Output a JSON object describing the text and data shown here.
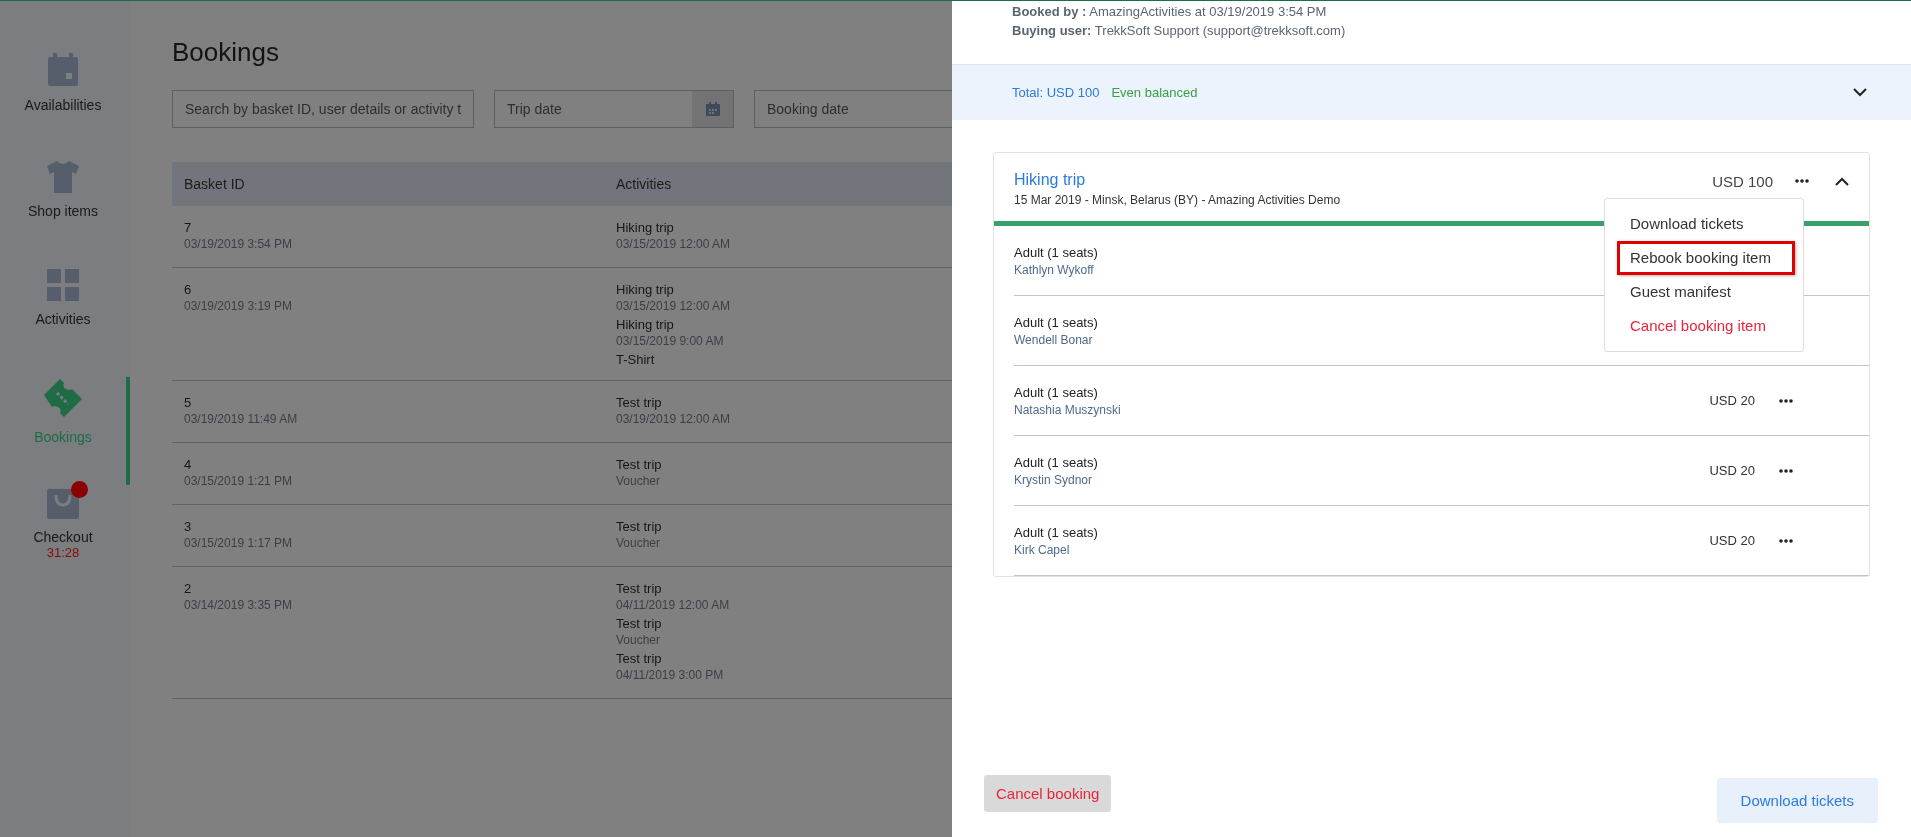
{
  "sidebar": {
    "items": [
      {
        "label": "Availabilities",
        "selected": false
      },
      {
        "label": "Shop items",
        "selected": false
      },
      {
        "label": "Activities",
        "selected": false
      },
      {
        "label": "Bookings",
        "selected": true
      },
      {
        "label": "Checkout",
        "selected": false,
        "notification": true,
        "timer": "31:28"
      }
    ]
  },
  "page": {
    "title": "Bookings",
    "filters": [
      {
        "kind": "text",
        "placeholder": "Search by basket ID, user details or activity t"
      },
      {
        "kind": "date",
        "placeholder": "Trip date"
      },
      {
        "kind": "date",
        "placeholder": "Booking date"
      }
    ],
    "table": {
      "columns": [
        "Basket ID",
        "Activities"
      ],
      "rows": [
        {
          "id": "7",
          "created": "03/19/2019 3:54 PM",
          "activities": [
            {
              "name": "Hiking trip",
              "detail": "03/15/2019 12:00 AM"
            }
          ]
        },
        {
          "id": "6",
          "created": "03/19/2019 3:19 PM",
          "activities": [
            {
              "name": "Hiking trip",
              "detail": "03/15/2019 12:00 AM"
            },
            {
              "name": "Hiking trip",
              "detail": "03/15/2019 9:00 AM"
            },
            {
              "name": "T-Shirt"
            }
          ]
        },
        {
          "id": "5",
          "created": "03/19/2019 11:49 AM",
          "activities": [
            {
              "name": "Test trip",
              "detail": "03/19/2019 12:00 AM"
            }
          ]
        },
        {
          "id": "4",
          "created": "03/15/2019 1:21 PM",
          "activities": [
            {
              "name": "Test trip",
              "detail": "Voucher"
            }
          ]
        },
        {
          "id": "3",
          "created": "03/15/2019 1:17 PM",
          "activities": [
            {
              "name": "Test trip",
              "detail": "Voucher"
            }
          ]
        },
        {
          "id": "2",
          "created": "03/14/2019 3:35 PM",
          "activities": [
            {
              "name": "Test trip",
              "detail": "04/11/2019 12:00 AM"
            },
            {
              "name": "Test trip",
              "detail": "Voucher"
            },
            {
              "name": "Test trip",
              "detail": "04/11/2019 3:00 PM"
            }
          ]
        }
      ]
    }
  },
  "drawer": {
    "info": [
      {
        "label": "Booked by :",
        "value": "AmazingActivities at 03/19/2019 3:54 PM"
      },
      {
        "label": "Buying user:",
        "value": "TrekkSoft Support (support@trekksoft.com)"
      }
    ],
    "total": {
      "amount": "Total: USD 100",
      "balance": "Even balanced",
      "expanded": false
    },
    "item": {
      "title": "Hiking trip",
      "subtitle": "15 Mar 2019 - Minsk, Belarus (BY) - Amazing Activities Demo",
      "price": "USD 100",
      "expanded": true,
      "rows": [
        {
          "type": "Adult (1 seats)",
          "guest": "Kathlyn Wykoff"
        },
        {
          "type": "Adult (1 seats)",
          "guest": "Wendell Bonar"
        },
        {
          "type": "Adult (1 seats)",
          "guest": "Natashia Muszynski",
          "price": "USD 20"
        },
        {
          "type": "Adult (1 seats)",
          "guest": "Krystin Sydnor",
          "price": "USD 20"
        },
        {
          "type": "Adult (1 seats)",
          "guest": "Kirk Capel",
          "price": "USD 20"
        }
      ],
      "menu": [
        {
          "label": "Download tickets",
          "kind": "normal",
          "highlighted": false
        },
        {
          "label": "Rebook booking item",
          "kind": "normal",
          "highlighted": true
        },
        {
          "label": "Guest manifest",
          "kind": "normal",
          "highlighted": false
        },
        {
          "label": "Cancel booking item",
          "kind": "danger",
          "highlighted": false
        }
      ]
    },
    "buttons": [
      {
        "label": "Cancel booking",
        "kind": "secondary"
      },
      {
        "label": "Download tickets",
        "kind": "primary"
      }
    ]
  }
}
